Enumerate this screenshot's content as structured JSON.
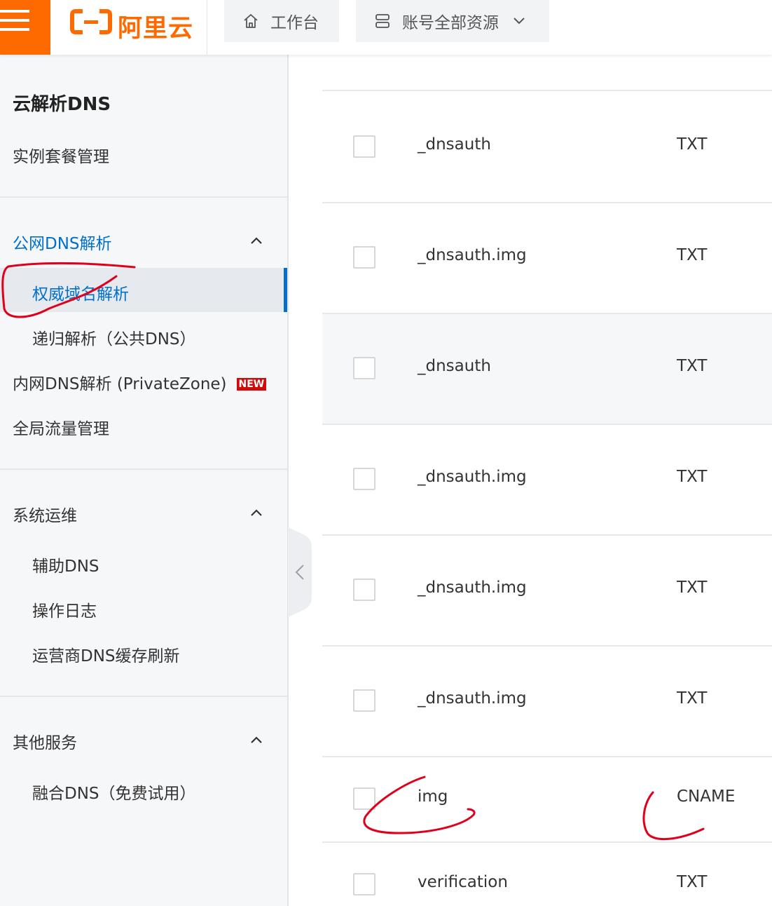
{
  "topbar": {
    "brand": "阿里云",
    "workbench_label": "工作台",
    "resources_label": "账号全部资源"
  },
  "sidebar": {
    "title": "云解析DNS",
    "instance_mgmt": "实例套餐管理",
    "public_dns": {
      "label": "公网DNS解析",
      "items": [
        "权威域名解析",
        "递归解析（公共DNS）"
      ]
    },
    "private_zone": {
      "label": "内网DNS解析 (PrivateZone)",
      "badge": "NEW"
    },
    "gtm": "全局流量管理",
    "ops": {
      "label": "系统运维",
      "items": [
        "辅助DNS",
        "操作日志",
        "运营商DNS缓存刷新"
      ]
    },
    "other": {
      "label": "其他服务",
      "items": [
        "融合DNS（免费试用）"
      ]
    }
  },
  "records": [
    {
      "host": "_dnsauth",
      "type": "TXT"
    },
    {
      "host": "_dnsauth.img",
      "type": "TXT"
    },
    {
      "host": "_dnsauth",
      "type": "TXT"
    },
    {
      "host": "_dnsauth.img",
      "type": "TXT"
    },
    {
      "host": "_dnsauth.img",
      "type": "TXT"
    },
    {
      "host": "_dnsauth.img",
      "type": "TXT"
    },
    {
      "host": "img",
      "type": "CNAME"
    },
    {
      "host": "verification",
      "type": "TXT"
    }
  ],
  "colors": {
    "brand": "#ff6a00",
    "accent": "#0070cc",
    "annotation": "#e0001b",
    "badge": "#d10a0a"
  }
}
